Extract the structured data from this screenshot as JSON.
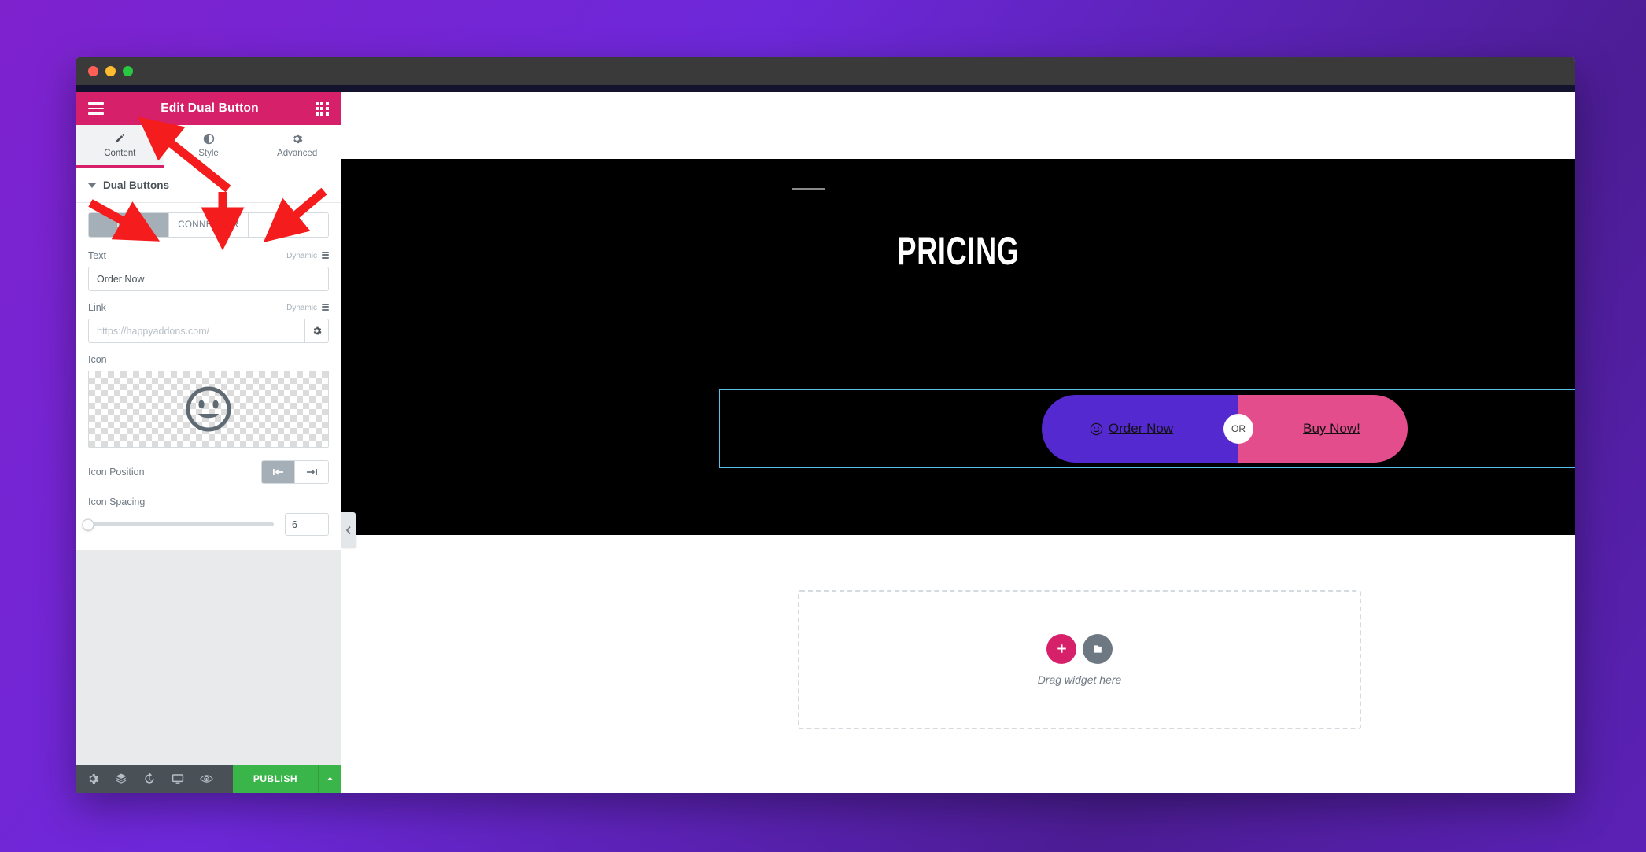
{
  "window": {
    "traffic_lights": [
      "close",
      "minimize",
      "maximize"
    ]
  },
  "panel": {
    "header": {
      "title": "Edit Dual Button",
      "menu_icon": "hamburger-icon",
      "grid_icon": "widgets-grid-icon"
    },
    "tabs": [
      {
        "label": "Content",
        "icon": "pencil-icon",
        "active": true
      },
      {
        "label": "Style",
        "icon": "contrast-icon",
        "active": false
      },
      {
        "label": "Advanced",
        "icon": "gear-icon",
        "active": false
      }
    ],
    "section": {
      "title": "Dual Buttons",
      "collapsed": false
    },
    "segments": [
      {
        "label": "LEFT",
        "active": true
      },
      {
        "label": "CONNECTOR",
        "active": false
      },
      {
        "label": "RIGHT",
        "active": false
      }
    ],
    "fields": {
      "text": {
        "label": "Text",
        "dynamic_label": "Dynamic",
        "value": "Order Now",
        "placeholder": ""
      },
      "link": {
        "label": "Link",
        "dynamic_label": "Dynamic",
        "value": "",
        "placeholder": "https://happyaddons.com/"
      },
      "icon": {
        "label": "Icon",
        "preview_icon": "smiley-face-icon"
      },
      "icon_position": {
        "label": "Icon Position",
        "options": [
          {
            "name": "before-icon",
            "active": true
          },
          {
            "name": "after-icon",
            "active": false
          }
        ]
      },
      "icon_spacing": {
        "label": "Icon Spacing",
        "value": "6",
        "slider_percent": 0
      }
    },
    "footer": {
      "icons": [
        "gear-icon",
        "layers-icon",
        "history-icon",
        "responsive-icon",
        "preview-eye-icon"
      ],
      "publish_label": "PUBLISH",
      "publish_caret": "caret-up-icon"
    },
    "collapse_tab": {
      "icon": "chevron-left-icon"
    }
  },
  "canvas": {
    "hero": {
      "title": "PRICING",
      "divider": "section-divider"
    },
    "widget": {
      "selected": true,
      "left_button": {
        "label": "Order Now",
        "icon": "smiley-face-icon",
        "color": "#5429d0"
      },
      "connector": {
        "label": "OR"
      },
      "right_button": {
        "label": "Buy Now!",
        "color": "#e34d8c"
      }
    },
    "dropzone": {
      "text": "Drag widget here",
      "add_icon": "plus-icon",
      "template_icon": "folder-template-icon"
    }
  },
  "annotations": {
    "arrow_color": "#f41c1c",
    "arrows": [
      {
        "name": "arrow-to-content-tab"
      },
      {
        "name": "arrow-to-left-tab"
      },
      {
        "name": "arrow-to-connector-tab"
      },
      {
        "name": "arrow-to-right-tab"
      }
    ]
  }
}
